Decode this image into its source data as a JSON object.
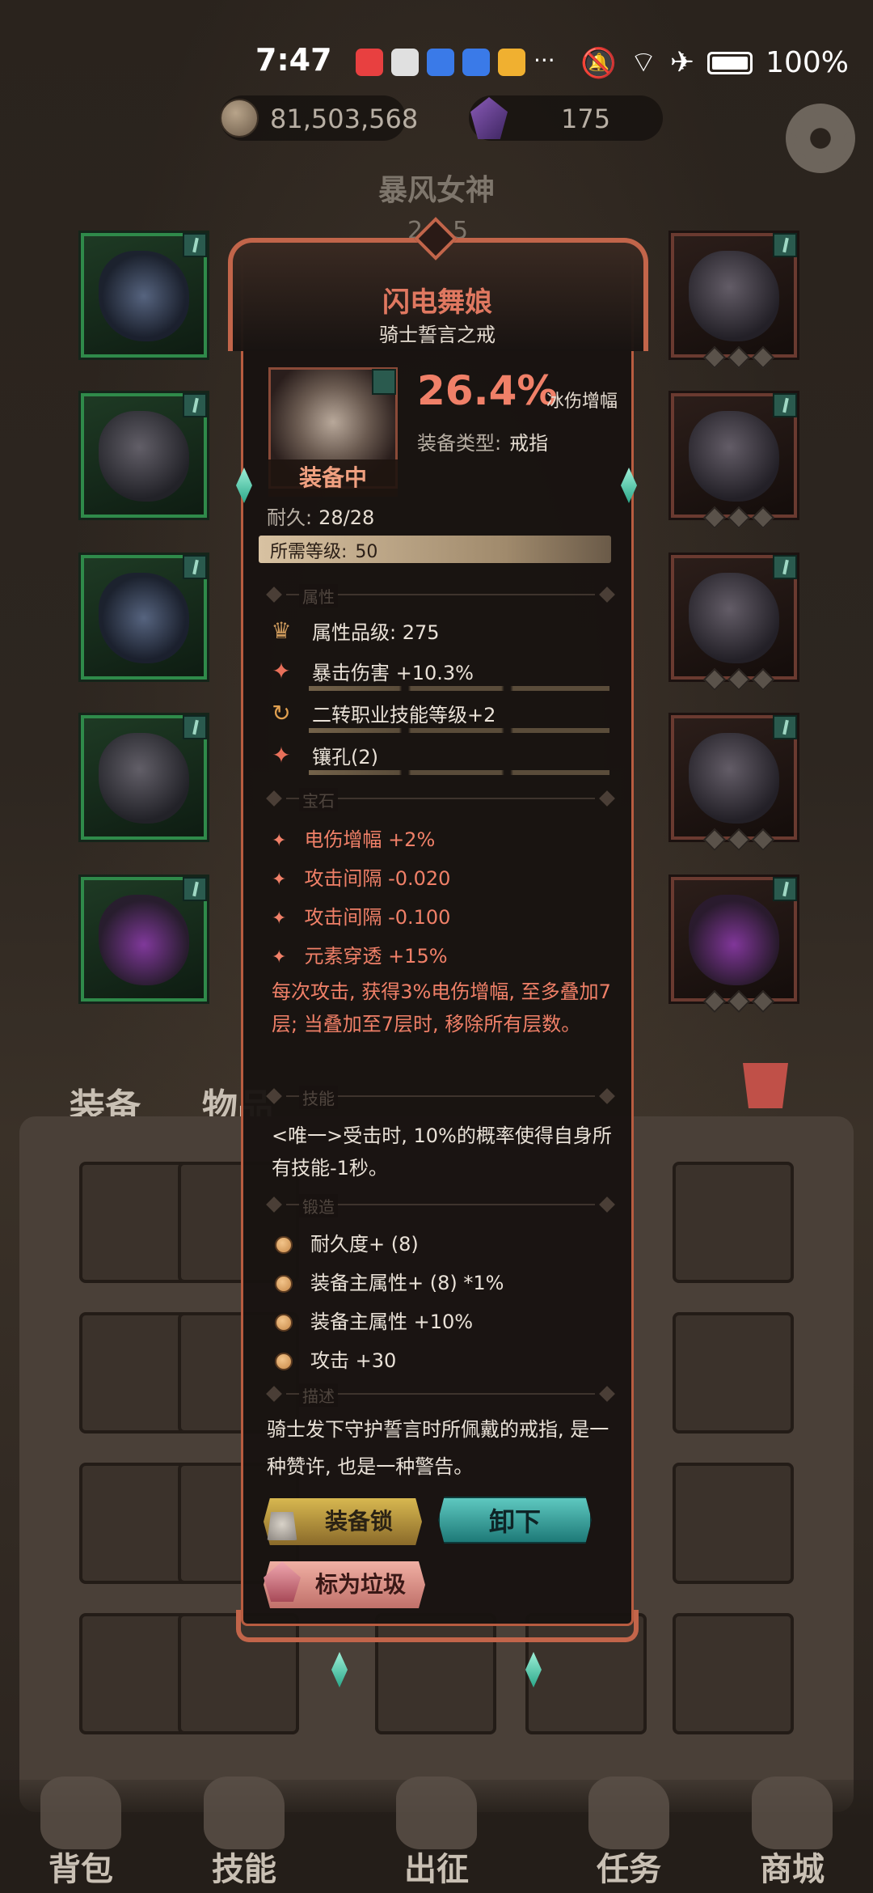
{
  "status_bar": {
    "time": "7:47",
    "more": "···",
    "battery": "100%",
    "notification_colors": [
      "#e84040",
      "#e0e0e0",
      "#3a7ae8",
      "#3a7ae8",
      "#f0b030"
    ]
  },
  "currency": {
    "coins": "81,503,568",
    "gems": "175"
  },
  "hero": {
    "name": "暴风女神",
    "page_current": "2",
    "page_total": "5"
  },
  "item": {
    "name": "闪电舞娘",
    "subtitle": "骑士誓言之戒",
    "equipped_label": "装备中",
    "main_stat_value": "26.4%",
    "main_stat_label": "冰伤增幅",
    "type_label": "装备类型:",
    "type_value": "戒指",
    "durability_label": "耐久:",
    "durability_value": "28/28",
    "level_label": "所需等级:",
    "level_value": "50"
  },
  "sections": {
    "attributes": "属性",
    "gems": "宝石",
    "skills": "技能",
    "forge": "锻造",
    "description": "描述"
  },
  "attributes": [
    {
      "icon": "crown-icon",
      "text": "属性品级: 275",
      "color": "#c8965a"
    },
    {
      "icon": "crit-star-icon",
      "text": "暴击伤害 +10.3%",
      "color": "#e8705a"
    },
    {
      "icon": "cycle-icon",
      "text": "二转职业技能等级+2",
      "color": "#e0a050"
    },
    {
      "icon": "socket-star-icon",
      "text": "镶孔(2)",
      "color": "#e8705a"
    }
  ],
  "gems": [
    "电伤增幅 +2%",
    "攻击间隔 -0.020",
    "攻击间隔 -0.100",
    "元素穿透 +15%"
  ],
  "gem_effect": "每次攻击, 获得3%电伤增幅, 至多叠加7层; 当叠加至7层时, 移除所有层数。",
  "skill_text": "<唯一>受击时, 10%的概率使得自身所有技能-1秒。",
  "forge": [
    "耐久度+ (8)",
    "装备主属性+ (8) *1%",
    "装备主属性 +10%",
    "攻击 +30"
  ],
  "description": "骑士发下守护誓言时所佩戴的戒指, 是一种赞许, 也是一种警告。",
  "buttons": {
    "lock": "装备锁",
    "unequip": "卸下",
    "mark_junk": "标为垃圾"
  },
  "bag_tabs": {
    "equipment": "装备",
    "items": "物品"
  },
  "bottom_nav": [
    "背包",
    "技能",
    "出征",
    "任务",
    "商城"
  ]
}
